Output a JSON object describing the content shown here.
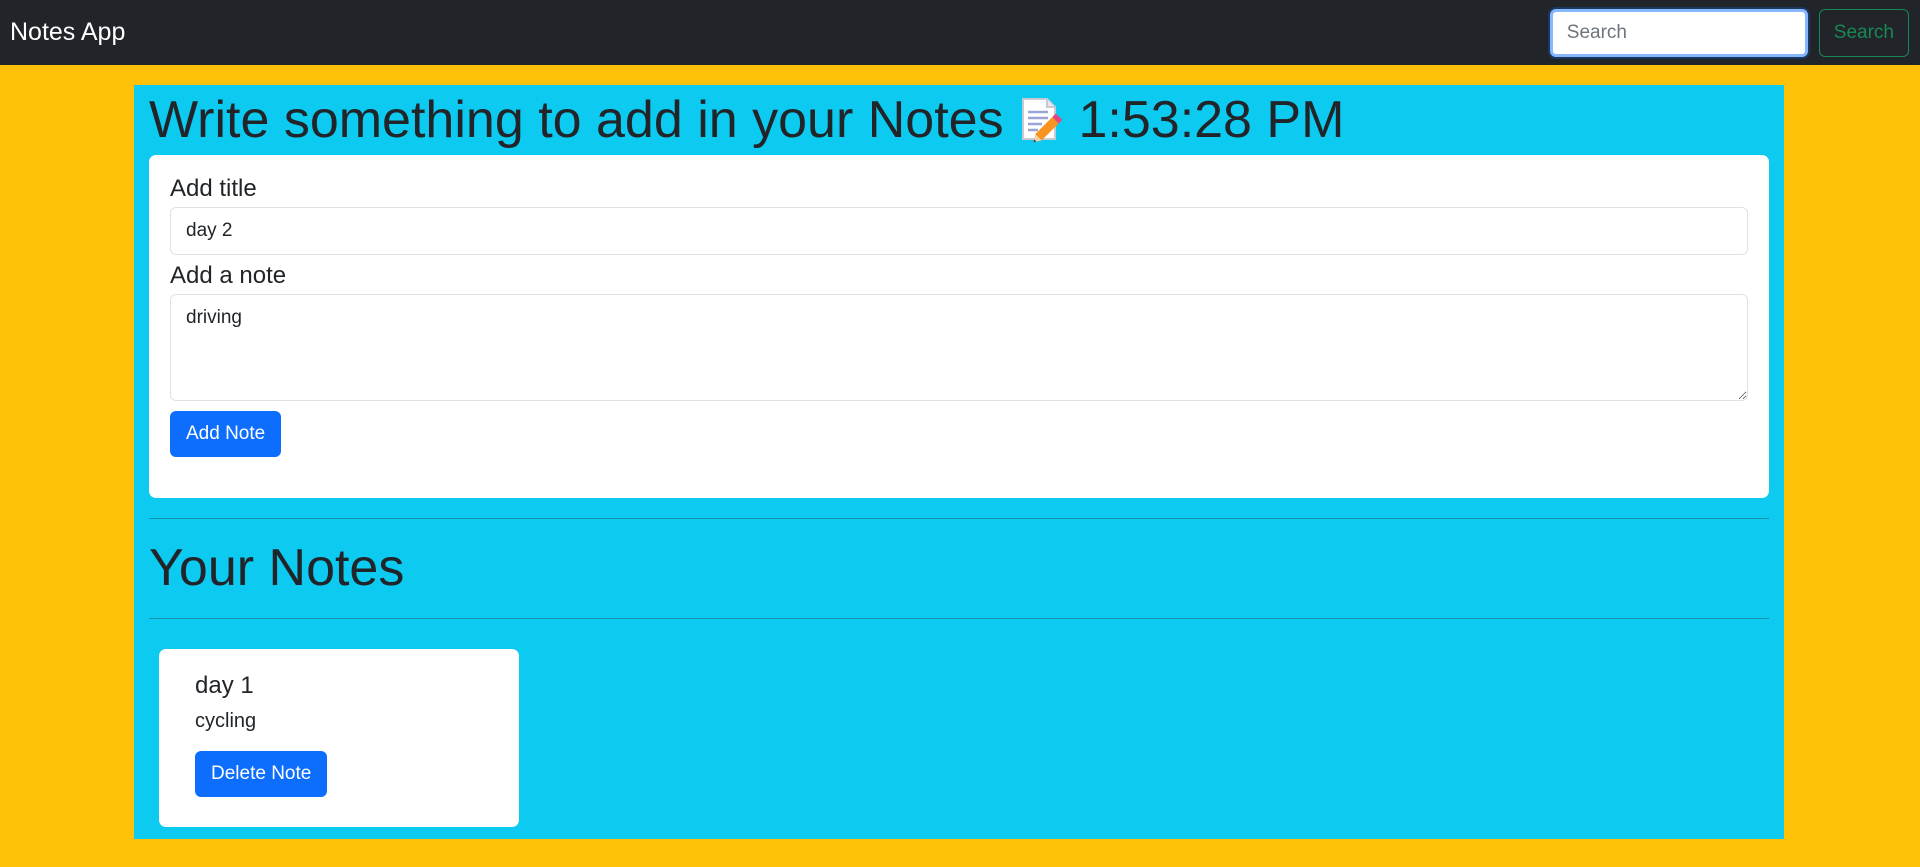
{
  "navbar": {
    "brand": "Notes App",
    "search_placeholder": "Search",
    "search_button": "Search"
  },
  "header": {
    "title_text": "Write something to add in your Notes",
    "title_icon": "memo-icon",
    "time": "1:53:28 PM"
  },
  "form": {
    "title_label": "Add title",
    "title_value": "day 2",
    "note_label": "Add a note",
    "note_value": "driving",
    "add_button": "Add Note"
  },
  "notes_section": {
    "heading": "Your Notes",
    "notes": [
      {
        "title": "day 1",
        "text": "cycling",
        "delete_button": "Delete Note"
      }
    ]
  },
  "colors": {
    "page_background": "#ffc107",
    "navbar_background": "#212529",
    "main_background": "#0dcaf0",
    "primary_button": "#0d6efd",
    "search_button": "#198754"
  }
}
